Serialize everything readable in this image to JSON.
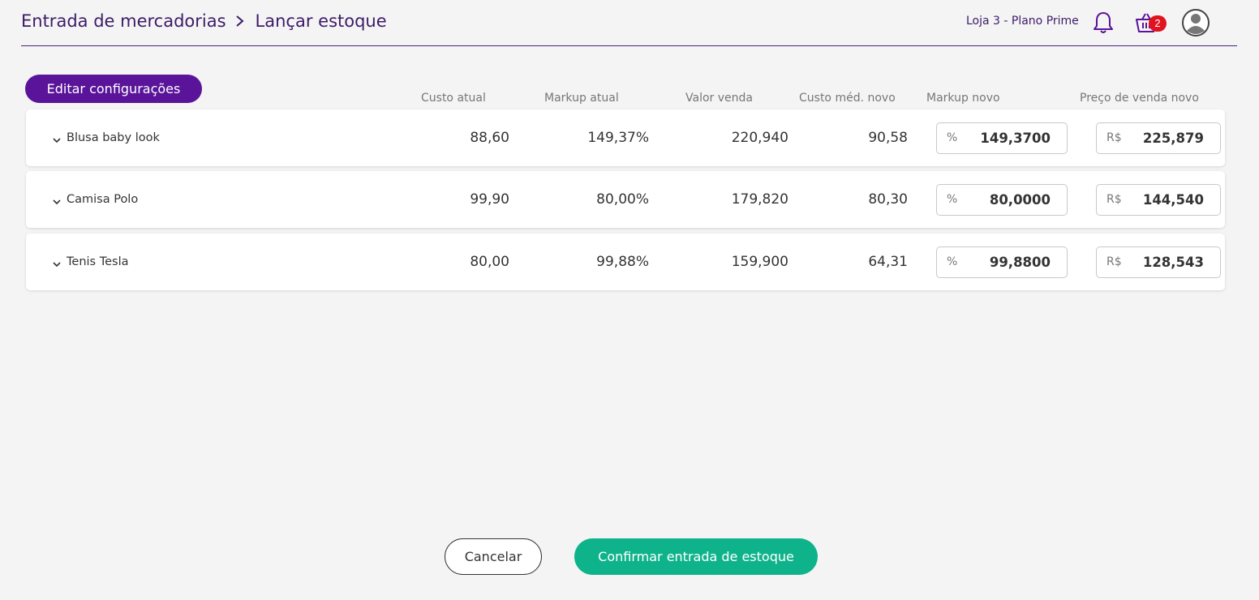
{
  "header": {
    "breadcrumb": [
      "Entrada de mercadorias",
      "Lançar estoque"
    ],
    "store": "Loja 3 - Plano Prime",
    "cart_count": "2",
    "icons": [
      "bell-icon",
      "basket-icon",
      "avatar-icon"
    ]
  },
  "toolbar": {
    "edit_label": "Editar configurações"
  },
  "columns": [
    "Custo atual",
    "Markup atual",
    "Valor venda",
    "Custo méd. novo",
    "Markup novo",
    "Preço de venda novo"
  ],
  "rows": [
    {
      "name": "Blusa baby look",
      "custo_atual": "88,60",
      "markup_atual": "149,37%",
      "valor_venda": "220,940",
      "custo_medio_novo": "90,58",
      "markup_prefix": "%",
      "markup_novo": "149,3700",
      "preco_prefix": "R$",
      "preco_novo": "225,879"
    },
    {
      "name": "Camisa Polo",
      "custo_atual": "99,90",
      "markup_atual": "80,00%",
      "valor_venda": "179,820",
      "custo_medio_novo": "80,30",
      "markup_prefix": "%",
      "markup_novo": "80,0000",
      "preco_prefix": "R$",
      "preco_novo": "144,540"
    },
    {
      "name": "Tenis Tesla",
      "custo_atual": "80,00",
      "markup_atual": "99,88%",
      "valor_venda": "159,900",
      "custo_medio_novo": "64,31",
      "markup_prefix": "%",
      "markup_novo": "99,8800",
      "preco_prefix": "R$",
      "preco_novo": "128,543"
    }
  ],
  "footer": {
    "cancel_label": "Cancelar",
    "confirm_label": "Confirmar entrada de estoque"
  },
  "colors": {
    "primary": "#5a149a",
    "header_text": "#3d1b68",
    "confirm": "#0fb38b",
    "badge": "#e0131f"
  }
}
